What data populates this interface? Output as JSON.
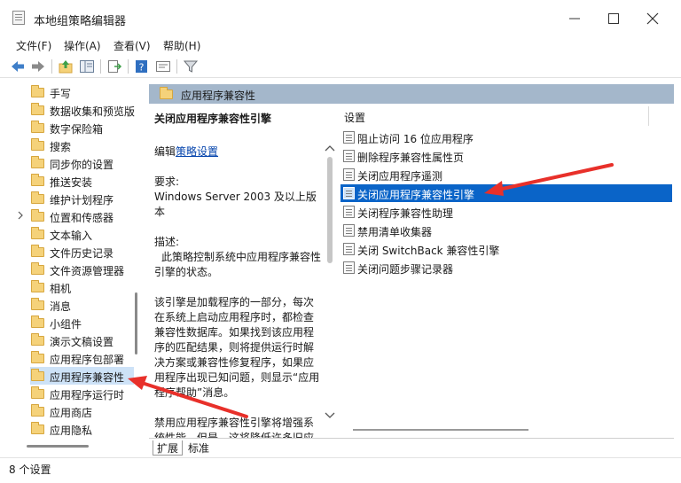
{
  "window": {
    "title": "本地组策略编辑器",
    "controls": [
      "minimize-icon",
      "maximize-icon",
      "close-icon"
    ]
  },
  "menu": [
    "文件(F)",
    "操作(A)",
    "查看(V)",
    "帮助(H)"
  ],
  "toolbar": [
    "back-arrow-icon",
    "forward-arrow-icon",
    "up-folder-icon",
    "show-hide-tree-icon",
    "export-list-icon",
    "help-icon",
    "properties-icon",
    "filter-icon"
  ],
  "tree": {
    "items": [
      {
        "label": "手写"
      },
      {
        "label": "数据收集和预览版"
      },
      {
        "label": "数字保险箱"
      },
      {
        "label": "搜索"
      },
      {
        "label": "同步你的设置"
      },
      {
        "label": "推送安装"
      },
      {
        "label": "维护计划程序"
      },
      {
        "label": "位置和传感器"
      },
      {
        "label": "文本输入"
      },
      {
        "label": "文件历史记录"
      },
      {
        "label": "文件资源管理器"
      },
      {
        "label": "相机"
      },
      {
        "label": "消息"
      },
      {
        "label": "小组件"
      },
      {
        "label": "演示文稿设置"
      },
      {
        "label": "应用程序包部署"
      },
      {
        "label": "应用程序兼容性"
      },
      {
        "label": "应用程序运行时"
      },
      {
        "label": "应用商店"
      },
      {
        "label": "应用隐私"
      }
    ],
    "selected_label": "应用程序兼容性",
    "expandable_label": "位置和传感器"
  },
  "right": {
    "header_title": "应用程序兼容性",
    "description": {
      "title": "关闭应用程序兼容性引擎",
      "edit_prefix": "编辑",
      "edit_link": "策略设置",
      "req_label": "要求:",
      "req_value": "Windows Server 2003 及以上版本",
      "desc_label": "描述:",
      "desc_text": "此策略控制系统中应用程序兼容性引擎的状态。",
      "body1": "该引擎是加载程序的一部分，每次在系统上启动应用程序时，都检查兼容性数据库。如果找到该应用程序的匹配结果，则将提供运行时解决方案或兼容性修复程序，如果应用程序出现已知问题，则显示“应用程序帮助”消息。",
      "body2": "禁用应用程序兼容性引擎将增强系统性能。但是，这将降低许多旧应"
    },
    "settings_header": "设置",
    "settings": [
      {
        "label": "阻止访问 16 位应用程序"
      },
      {
        "label": "删除程序兼容性属性页"
      },
      {
        "label": "关闭应用程序遥测"
      },
      {
        "label": "关闭应用程序兼容性引擎"
      },
      {
        "label": "关闭程序兼容性助理"
      },
      {
        "label": "禁用清单收集器"
      },
      {
        "label": "关闭 SwitchBack 兼容性引擎"
      },
      {
        "label": "关闭问题步骤记录器"
      }
    ],
    "selected_setting": "关闭应用程序兼容性引擎",
    "tabs": [
      "扩展",
      "标准"
    ],
    "active_tab": "扩展"
  },
  "status": "8 个设置",
  "colors": {
    "selection_blue": "#0a64c8",
    "header_bg": "#a4b7cb",
    "tree_selection": "#cde2f7",
    "annotation_red": "#e8302a"
  }
}
